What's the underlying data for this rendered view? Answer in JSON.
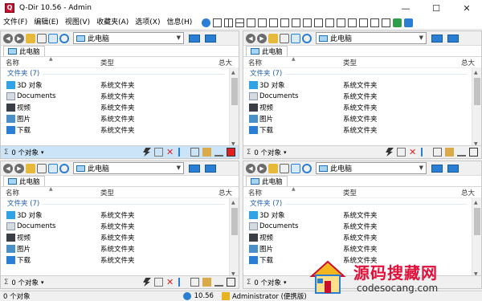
{
  "window": {
    "title": "Q-Dir 10.56 - Admin",
    "app_icon_letter": "Q"
  },
  "window_buttons": {
    "minimize": "—",
    "maximize": "☐",
    "close": "✕"
  },
  "menu": [
    "文件(F)",
    "编辑(E)",
    "视图(V)",
    "收藏夹(A)",
    "选项(X)",
    "信息(H)"
  ],
  "address": {
    "label": "此电脑"
  },
  "tab": {
    "label": "此电脑"
  },
  "columns": {
    "name": "名称",
    "type": "类型",
    "size": "总大"
  },
  "group": {
    "label": "文件夹 (7)"
  },
  "files": [
    {
      "name": "3D 对象",
      "type": "系统文件夹",
      "icon": "3d-objects-icon"
    },
    {
      "name": "Documents",
      "type": "系统文件夹",
      "icon": "documents-icon"
    },
    {
      "name": "视频",
      "type": "系统文件夹",
      "icon": "videos-icon"
    },
    {
      "name": "图片",
      "type": "系统文件夹",
      "icon": "pictures-icon"
    },
    {
      "name": "下载",
      "type": "系统文件夹",
      "icon": "downloads-icon"
    }
  ],
  "status": {
    "sigma": "Σ",
    "count": "0 个对象",
    "caret": "▾"
  },
  "bottombar": {
    "count": "0 个对象",
    "version": "10.56",
    "user": "Administrator (便携版)"
  },
  "watermark": {
    "title": "源码搜藏网",
    "url": "codesocang.com"
  },
  "colors": {
    "accent": "#1e6fc8",
    "active_status": "#cce4f7",
    "delete_red": "#e02020",
    "wm_red": "#e0103a"
  }
}
